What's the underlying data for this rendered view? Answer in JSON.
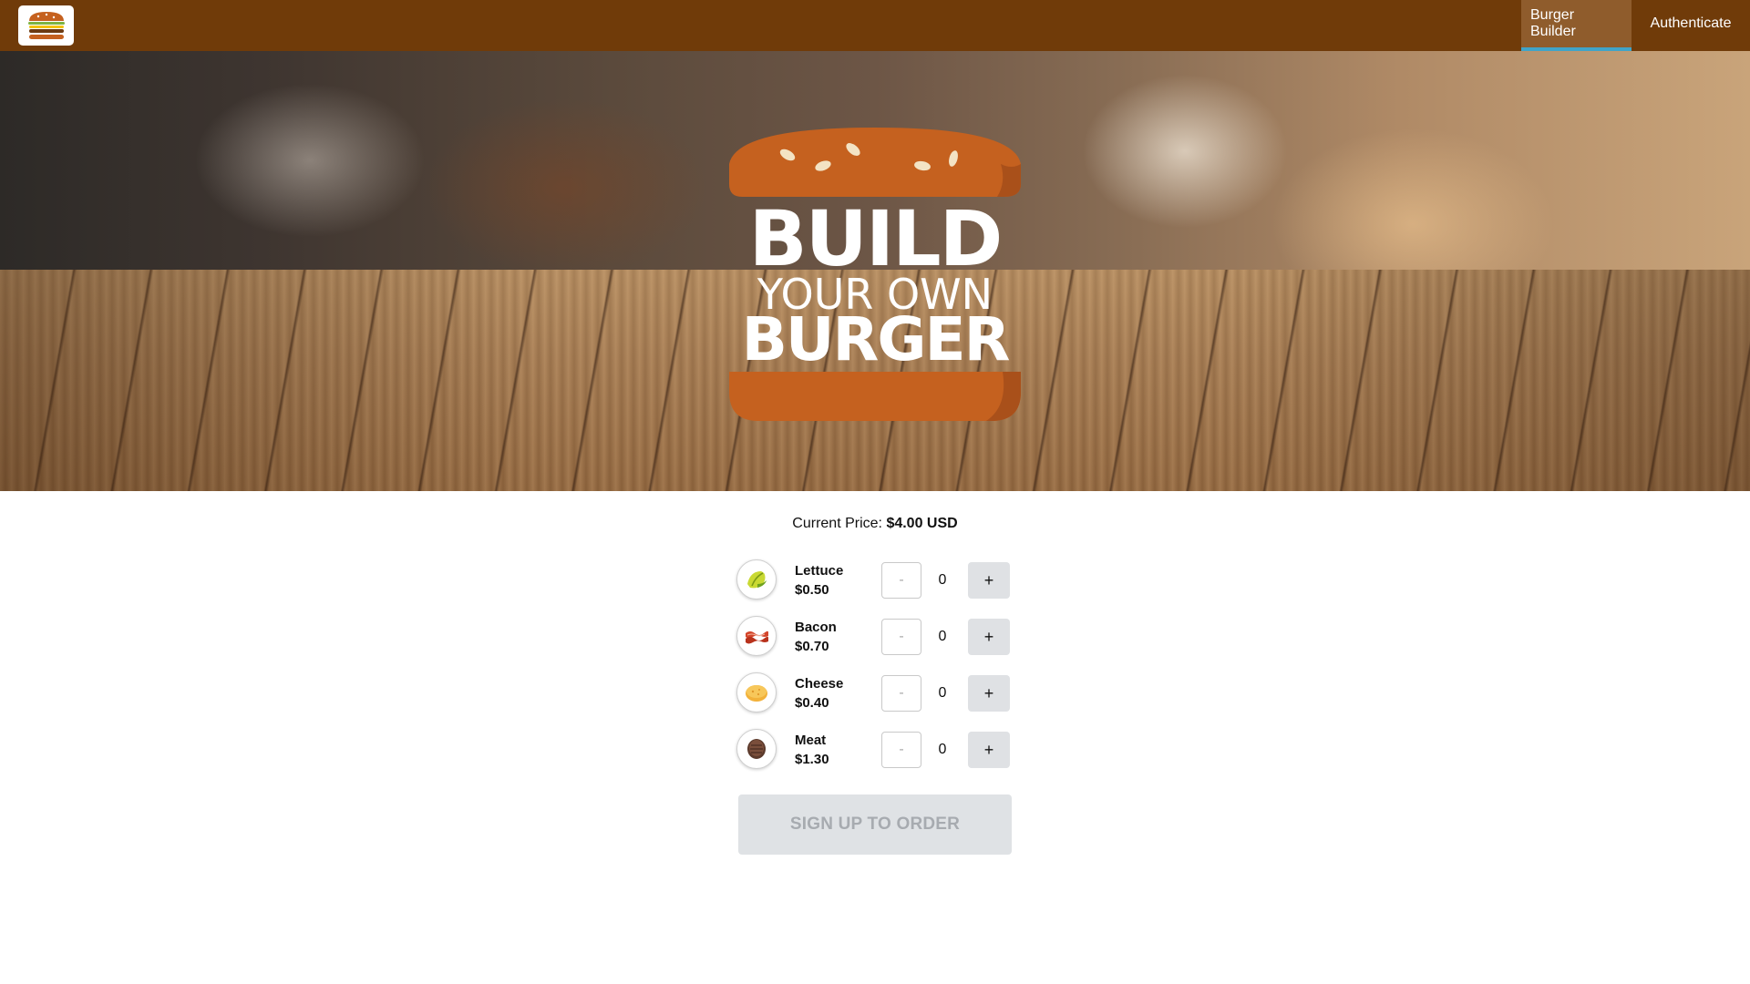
{
  "nav": {
    "logo_icon": "burger-logo-icon",
    "items": [
      {
        "label": "Burger Builder",
        "active": true
      },
      {
        "label": "Authenticate",
        "active": false
      }
    ]
  },
  "hero": {
    "line1": "BUILD",
    "line2": "YOUR OWN",
    "line3": "BURGER"
  },
  "builder": {
    "price_label": "Current Price:",
    "price_value": "$4.00 USD",
    "ingredients": [
      {
        "name": "Lettuce",
        "price": "$0.50",
        "qty": "0",
        "icon": "lettuce-icon"
      },
      {
        "name": "Bacon",
        "price": "$0.70",
        "qty": "0",
        "icon": "bacon-icon"
      },
      {
        "name": "Cheese",
        "price": "$0.40",
        "qty": "0",
        "icon": "cheese-icon"
      },
      {
        "name": "Meat",
        "price": "$1.30",
        "qty": "0",
        "icon": "meat-icon"
      }
    ],
    "minus_label": "-",
    "plus_label": "+",
    "order_label": "SIGN UP TO ORDER"
  },
  "colors": {
    "topbar": "#703b09",
    "active_tab_underline": "#40a4c8",
    "bun": "#c5611f",
    "order_button_disabled": "#dfe2e5"
  }
}
